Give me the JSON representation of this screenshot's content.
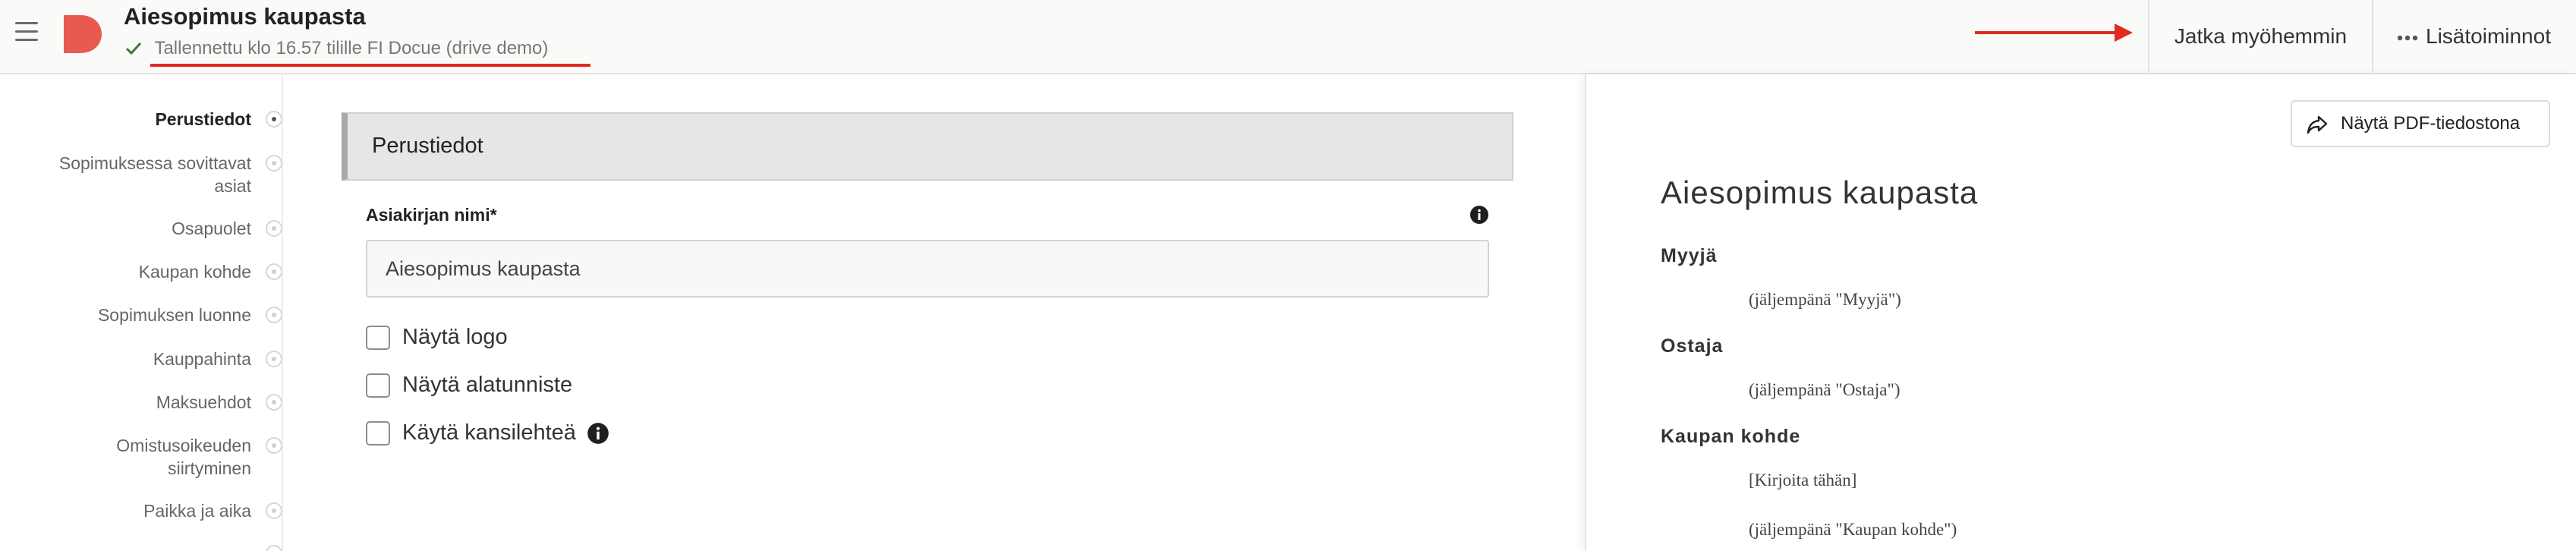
{
  "header": {
    "document_title": "Aiesopimus kaupasta",
    "saved_status": "Tallennettu klo 16.57 tilille FI Docue (drive demo)",
    "continue_later_label": "Jatka myöhemmin",
    "more_actions_label": "Lisätoiminnot",
    "icons": {
      "menu": "hamburger-menu-icon",
      "logo": "docue-logo",
      "saved": "checkmark-icon",
      "annotation_arrow": "red-arrow-annotation",
      "more": "ellipsis-icon"
    },
    "colors": {
      "logo": "#e85a4f",
      "annotation": "#e02a1e",
      "check": "#3c7a3c"
    }
  },
  "sidebar": {
    "items": [
      {
        "label": "Perustiedot",
        "active": true
      },
      {
        "label": "Sopimuksessa sovittavat asiat",
        "active": false
      },
      {
        "label": "Osapuolet",
        "active": false
      },
      {
        "label": "Kaupan kohde",
        "active": false
      },
      {
        "label": "Sopimuksen luonne",
        "active": false
      },
      {
        "label": "Kauppahinta",
        "active": false
      },
      {
        "label": "Maksuehdot",
        "active": false
      },
      {
        "label": "Omistusoikeuden siirtyminen",
        "active": false
      },
      {
        "label": "Paikka ja aika",
        "active": false
      }
    ]
  },
  "form": {
    "section_title": "Perustiedot",
    "document_name_label": "Asiakirjan nimi*",
    "document_name_value": "Aiesopimus kaupasta",
    "checkboxes": [
      {
        "label": "Näytä logo",
        "checked": false
      },
      {
        "label": "Näytä alatunniste",
        "checked": false
      },
      {
        "label": "Käytä kansilehteä",
        "checked": false
      }
    ],
    "info_icon": "info-icon"
  },
  "preview": {
    "pdf_button_label": "Näytä PDF-tiedostona",
    "pdf_button_icon": "share-arrow-icon",
    "title": "Aiesopimus kaupasta",
    "sections": [
      {
        "heading": "Myyjä",
        "lines": [
          "(jäljempänä \"Myyjä\")"
        ]
      },
      {
        "heading": "Ostaja",
        "lines": [
          "(jäljempänä \"Ostaja\")"
        ]
      },
      {
        "heading": "Kaupan kohde",
        "lines": [
          "[Kirjoita tähän]",
          "(jäljempänä \"Kaupan kohde\")"
        ]
      }
    ]
  }
}
